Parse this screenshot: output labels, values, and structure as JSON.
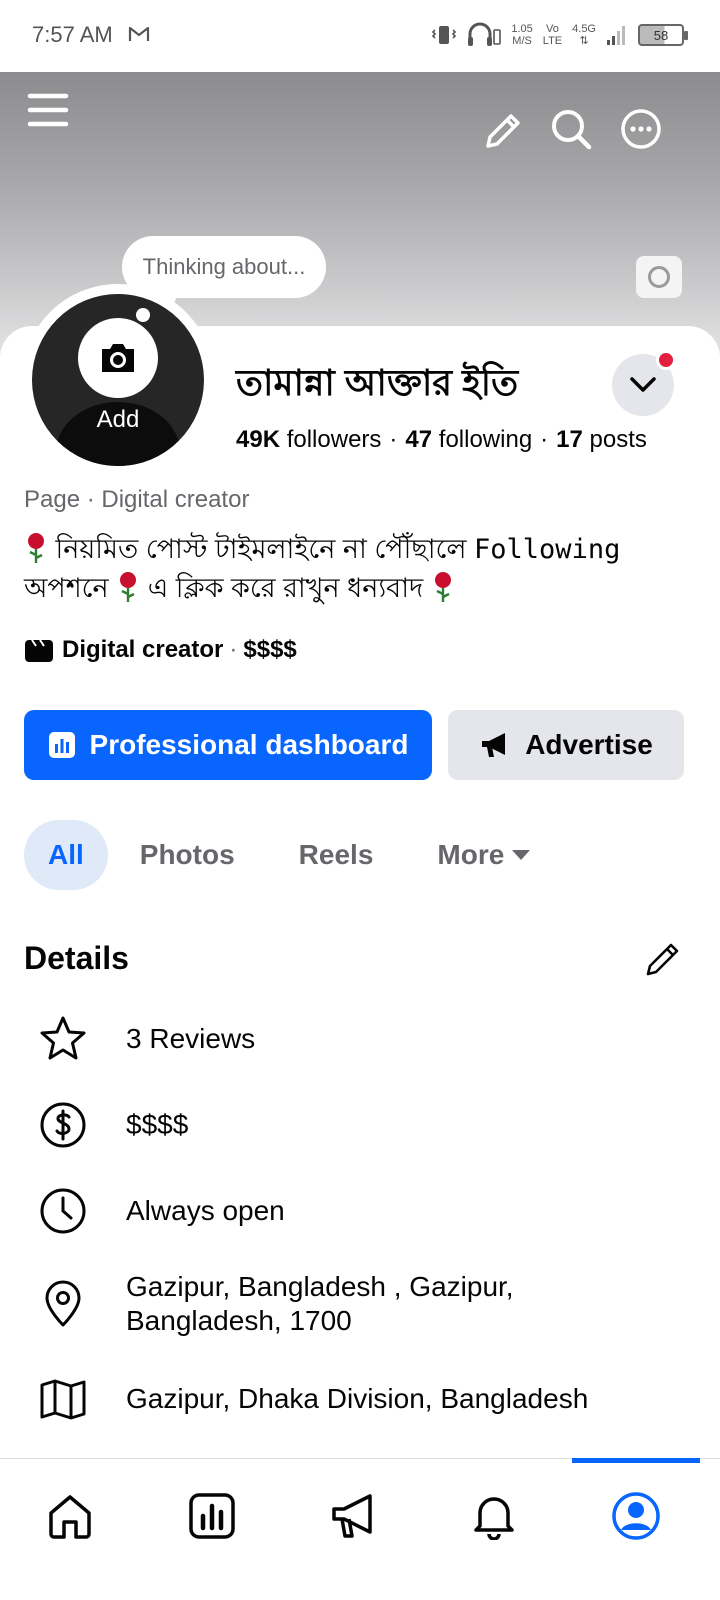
{
  "status_bar": {
    "time": "7:57 AM",
    "speed_value": "1.05",
    "speed_unit": "M/S",
    "volte_top": "Vo",
    "volte_bottom": "LTE",
    "network": "4.5G",
    "battery": "58"
  },
  "cover": {
    "thought_bubble": "Thinking about..."
  },
  "profile": {
    "avatar_add_label": "Add",
    "name": "তামান্না আক্তার ইতি",
    "followers_count": "49K",
    "followers_label": "followers",
    "following_count": "47",
    "following_label": "following",
    "posts_count": "17",
    "posts_label": "posts",
    "page_meta": "Page · Digital creator",
    "bio_part1": "নিয়মিত পোস্ট টাইমলাইনে না পৌঁছালে",
    "bio_following": "Following",
    "bio_part2": "অপশনে",
    "bio_part3": "এ ক্লিক করে রাখুন ধন্যবাদ",
    "category": "Digital creator",
    "price_range": "$$$$"
  },
  "actions": {
    "dashboard_label": "Professional dashboard",
    "advertise_label": "Advertise"
  },
  "tabs": [
    {
      "label": "All"
    },
    {
      "label": "Photos"
    },
    {
      "label": "Reels"
    },
    {
      "label": "More"
    }
  ],
  "details": {
    "title": "Details",
    "rows": [
      {
        "icon": "star-icon",
        "text": "3 Reviews"
      },
      {
        "icon": "dollar-icon",
        "text": "$$$$"
      },
      {
        "icon": "clock-icon",
        "text": "Always open"
      },
      {
        "icon": "location-pin-icon",
        "text_line1": "Gazipur, Bangladesh , Gazipur,",
        "text_line2": "Bangladesh, 1700"
      },
      {
        "icon": "map-icon",
        "text": "Gazipur, Dhaka Division, Bangladesh"
      }
    ]
  },
  "bottom_nav": [
    "home-icon",
    "dashboard-icon",
    "megaphone-icon",
    "bell-icon",
    "profile-icon"
  ],
  "colors": {
    "accent": "#0866ff",
    "notification": "#e41e3f",
    "secondary_text": "#65676b",
    "button_gray": "#e4e6eb"
  }
}
